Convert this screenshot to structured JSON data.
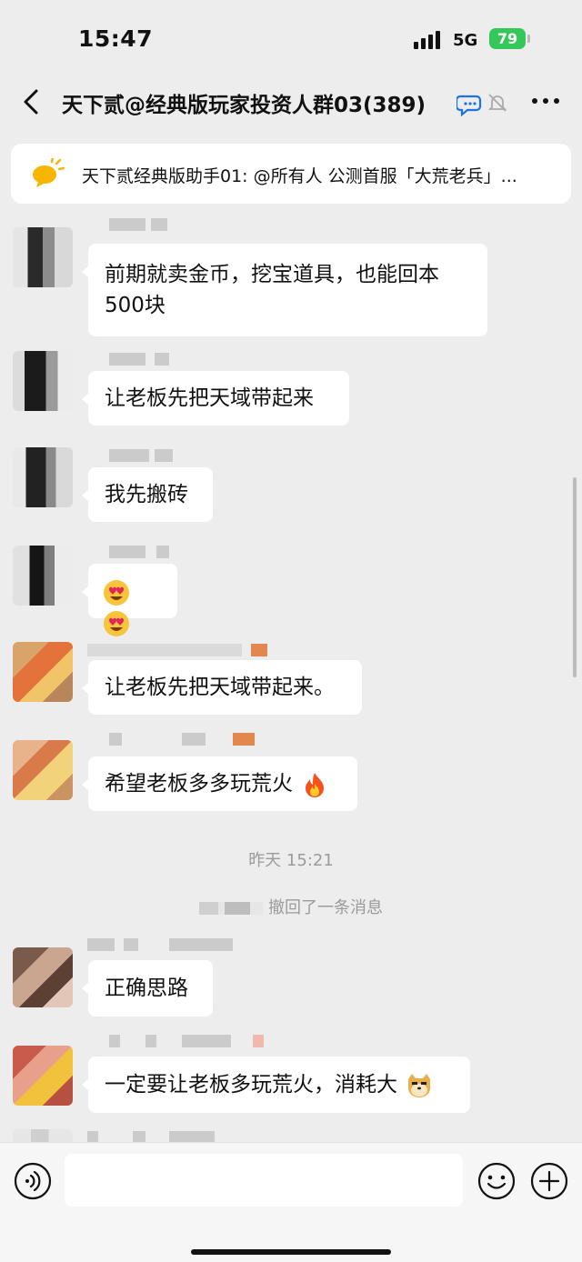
{
  "status_bar": {
    "time": "15:47",
    "network": "5G",
    "battery": "79"
  },
  "header": {
    "title": "天下贰@经典版玩家投资人群03(389)"
  },
  "notice": {
    "text": "天下贰经典版助手01: @所有人  公测首服「大荒老兵」..."
  },
  "messages": [
    {
      "text": "前期就卖金币，挖宝道具，也能回本500块"
    },
    {
      "text": "让老板先把天域带起来"
    },
    {
      "text": "我先搬砖"
    },
    {
      "text": "",
      "emoji": [
        "heart-eyes-emoji",
        "heart-eyes-emoji"
      ]
    },
    {
      "text": "让老板先把天域带起来。"
    },
    {
      "text": "希望老板多多玩荒火",
      "emoji": [
        "fire-emoji"
      ]
    },
    {
      "text": "正确思路"
    },
    {
      "text": "一定要让老板多玩荒火，消耗大",
      "emoji": [
        "doge-emoji"
      ]
    }
  ],
  "separator": {
    "time": "昨天 15:21"
  },
  "recall": {
    "text": "撤回了一条消息"
  },
  "colors": {
    "background": "#ededed",
    "bubble": "#ffffff",
    "battery": "#34c759",
    "system_text": "#9b9b9b"
  },
  "input_bar": {
    "voice_icon": "voice-icon",
    "emoji_icon": "smile-icon",
    "plus_icon": "plus-icon"
  }
}
